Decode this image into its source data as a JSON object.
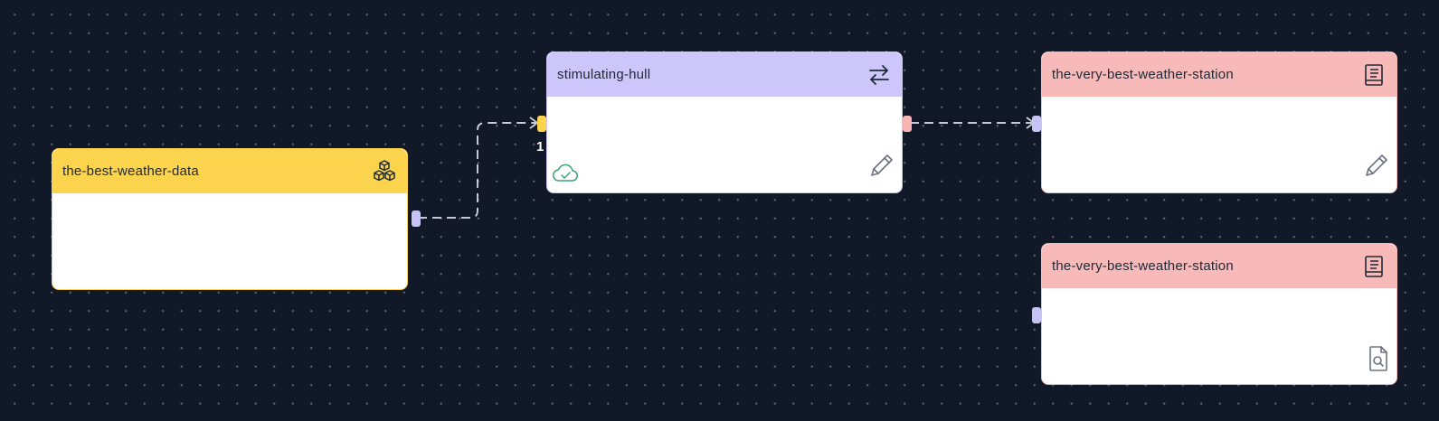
{
  "canvas": {
    "background": "#111827",
    "dot_color": "#5b6272"
  },
  "nodes": [
    {
      "id": "dataset",
      "title": "the-best-weather-data",
      "header_color": "#fcd34d",
      "type_icon": "cubes-icon",
      "body_icon": ""
    },
    {
      "id": "transform",
      "title": "stimulating-hull",
      "header_color": "#cdc6fa",
      "type_icon": "arrows-exchange-icon",
      "body_icon": "pencil-icon",
      "status_icon": "cloud-check-icon",
      "input_count": "1"
    },
    {
      "id": "output-1",
      "title": "the-very-best-weather-station",
      "header_color": "#f8b9b9",
      "type_icon": "book-icon",
      "body_icon": "pencil-icon"
    },
    {
      "id": "output-2",
      "title": "the-very-best-weather-station",
      "header_color": "#f8b9b9",
      "type_icon": "book-icon",
      "body_icon": "file-search-icon"
    }
  ],
  "colors": {
    "edge": "#c4c9d4",
    "status_green": "#3aa676",
    "icon_gray": "#6b7280"
  }
}
